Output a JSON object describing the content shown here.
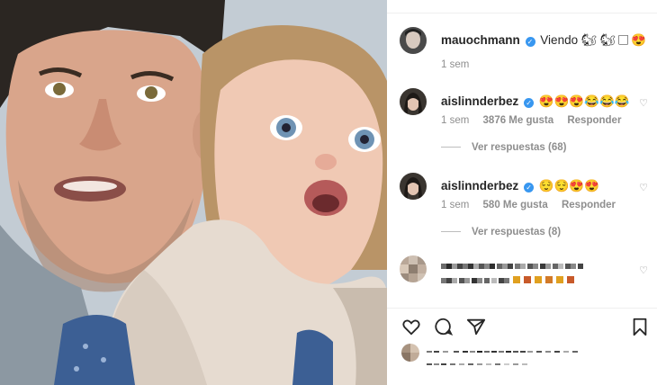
{
  "post": {
    "author": {
      "username": "mauochmann",
      "caption": "Viendo 🐿 🐿◻😍",
      "time": "1 sem"
    }
  },
  "comments": [
    {
      "username": "aislinnderbez",
      "text": "😍😍😍😂😂😂",
      "time": "1 sem",
      "likes": "3876 Me gusta",
      "reply_label": "Responder",
      "view_replies": "Ver respuestas (68)"
    },
    {
      "username": "aislinnderbez",
      "text": "😌😌😍😍",
      "time": "1 sem",
      "likes": "580 Me gusta",
      "reply_label": "Responder",
      "view_replies": "Ver respuestas (8)"
    }
  ],
  "icons": {
    "verified": "verified-badge-icon",
    "like": "heart-icon",
    "comment": "comment-icon",
    "share": "share-icon",
    "save": "bookmark-icon"
  },
  "colors": {
    "verified": "#3897f0",
    "meta_text": "#8e8e8e",
    "text": "#262626"
  }
}
